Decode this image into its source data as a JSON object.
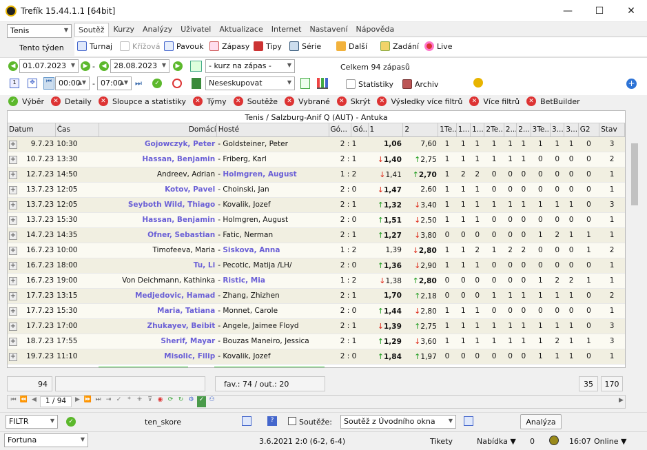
{
  "window": {
    "title": "Trefík 15.44.1.1 [64bit]",
    "minimize": "—",
    "maximize": "☐",
    "close": "✕"
  },
  "sport_select": "Tenis",
  "period_label": "Tento týden",
  "tabs": [
    "Soutěž",
    "Kurzy",
    "Analýzy",
    "Uživatel",
    "Aktualizace",
    "Internet",
    "Nastavení",
    "Nápověda"
  ],
  "toolbar": [
    "Turnaj",
    "Křížová",
    "Pavouk",
    "Zápasy",
    "Tipy",
    "Série",
    "Další",
    "Zadání",
    "Live"
  ],
  "filters": {
    "date_from": "01.07.2023",
    "date_sep": "-",
    "date_to": "28.08.2023",
    "odds_select": "- kurz na zápas -",
    "total_label": "Celkem 94 zápasů",
    "time_from": "00:00",
    "time_sep": "-",
    "time_to": "07:00",
    "group_select": "Neseskupovat",
    "stats_label": "Statistiky",
    "archive_label": "Archiv"
  },
  "filter_tabs": [
    "Výběr",
    "Detaily",
    "Sloupce a statistiky",
    "Týmy",
    "Soutěže",
    "Vybrané",
    "Skrýt",
    "Výsledky více filtrů",
    "Více filtrů",
    "BetBuilder"
  ],
  "grid": {
    "title": "Tenis / Salzburg-Anif Q (AUT)  - Antuka",
    "columns": [
      "Datum",
      "Čas",
      "Domácí",
      "Hosté",
      "Gó...",
      "Gó...",
      "1",
      "2",
      "1Te...",
      "1...",
      "1...",
      "2Te...",
      "2...",
      "2...",
      "3Te...",
      "3...",
      "3...",
      "G2",
      "Stav"
    ],
    "rows": [
      {
        "date": "9.7.23",
        "time": "10:30",
        "home": "Gojowczyk, Peter",
        "away": "Goldsteiner, Peter",
        "score": "2 : 1",
        "o1": "1,06",
        "o1a": "",
        "o2": "7,60",
        "o2a": "",
        "fav": "home",
        "s": [
          "1",
          "1",
          "1",
          "1",
          "1",
          "1",
          "1",
          "1",
          "1",
          "0",
          "3"
        ]
      },
      {
        "date": "10.7.23",
        "time": "13:30",
        "home": "Hassan, Benjamin",
        "away": "Friberg, Karl",
        "score": "2 : 1",
        "o1": "1,40",
        "o1a": "dn",
        "o2": "2,75",
        "o2a": "up",
        "fav": "home",
        "s": [
          "1",
          "1",
          "1",
          "1",
          "1",
          "1",
          "0",
          "0",
          "0",
          "0",
          "2"
        ]
      },
      {
        "date": "12.7.23",
        "time": "14:50",
        "home": "Andreev, Adrian",
        "away": "Holmgren, August",
        "score": "1 : 2",
        "o1": "1,41",
        "o1a": "dn",
        "o2": "2,70",
        "o2a": "up",
        "fav": "away",
        "s": [
          "1",
          "2",
          "2",
          "0",
          "0",
          "0",
          "0",
          "0",
          "0",
          "0",
          "1"
        ]
      },
      {
        "date": "13.7.23",
        "time": "12:05",
        "home": "Kotov, Pavel",
        "away": "Choinski, Jan",
        "score": "2 : 0",
        "o1": "1,47",
        "o1a": "dn",
        "o2": "2,60",
        "o2a": "",
        "fav": "home",
        "s": [
          "1",
          "1",
          "1",
          "0",
          "0",
          "0",
          "0",
          "0",
          "0",
          "0",
          "1"
        ]
      },
      {
        "date": "13.7.23",
        "time": "12:05",
        "home": "Seyboth Wild, Thiago",
        "away": "Kovalik, Jozef",
        "score": "2 : 1",
        "o1": "1,32",
        "o1a": "up",
        "o2": "3,40",
        "o2a": "dn",
        "fav": "home",
        "s": [
          "1",
          "1",
          "1",
          "1",
          "1",
          "1",
          "1",
          "1",
          "1",
          "0",
          "3"
        ]
      },
      {
        "date": "13.7.23",
        "time": "15:30",
        "home": "Hassan, Benjamin",
        "away": "Holmgren, August",
        "score": "2 : 0",
        "o1": "1,51",
        "o1a": "up",
        "o2": "2,50",
        "o2a": "dn",
        "fav": "home",
        "s": [
          "1",
          "1",
          "1",
          "0",
          "0",
          "0",
          "0",
          "0",
          "0",
          "0",
          "1"
        ]
      },
      {
        "date": "14.7.23",
        "time": "14:35",
        "home": "Ofner, Sebastian",
        "away": "Fatic, Nerman",
        "score": "2 : 1",
        "o1": "1,27",
        "o1a": "up",
        "o2": "3,80",
        "o2a": "dn",
        "fav": "home",
        "s": [
          "0",
          "0",
          "0",
          "0",
          "0",
          "0",
          "1",
          "2",
          "1",
          "1",
          "1"
        ]
      },
      {
        "date": "16.7.23",
        "time": "10:00",
        "home": "Timofeeva, Maria",
        "away": "Siskova, Anna",
        "score": "1 : 2",
        "o1": "1,39",
        "o1a": "",
        "o2": "2,80",
        "o2a": "dn",
        "fav": "away",
        "s": [
          "1",
          "1",
          "2",
          "1",
          "2",
          "2",
          "0",
          "0",
          "0",
          "1",
          "2"
        ]
      },
      {
        "date": "16.7.23",
        "time": "18:00",
        "home": "Tu, Li",
        "away": "Pecotic, Matija /LH/",
        "score": "2 : 0",
        "o1": "1,36",
        "o1a": "up",
        "o2": "2,90",
        "o2a": "dn",
        "fav": "home",
        "s": [
          "1",
          "1",
          "1",
          "0",
          "0",
          "0",
          "0",
          "0",
          "0",
          "0",
          "1"
        ]
      },
      {
        "date": "16.7.23",
        "time": "19:00",
        "home": "Von Deichmann, Kathinka",
        "away": "Ristic, Mia",
        "score": "1 : 2",
        "o1": "1,38",
        "o1a": "dn",
        "o2": "2,80",
        "o2a": "up",
        "fav": "away",
        "s": [
          "0",
          "0",
          "0",
          "0",
          "0",
          "0",
          "1",
          "2",
          "2",
          "1",
          "1"
        ]
      },
      {
        "date": "17.7.23",
        "time": "13:15",
        "home": "Medjedovic, Hamad",
        "away": "Zhang, Zhizhen",
        "score": "2 : 1",
        "o1": "1,70",
        "o1a": "",
        "o2": "2,18",
        "o2a": "up",
        "fav": "home",
        "s": [
          "0",
          "0",
          "0",
          "1",
          "1",
          "1",
          "1",
          "1",
          "1",
          "0",
          "2"
        ]
      },
      {
        "date": "17.7.23",
        "time": "15:30",
        "home": "Maria, Tatiana",
        "away": "Monnet, Carole",
        "score": "2 : 0",
        "o1": "1,44",
        "o1a": "up",
        "o2": "2,80",
        "o2a": "dn",
        "fav": "home",
        "s": [
          "1",
          "1",
          "1",
          "0",
          "0",
          "0",
          "0",
          "0",
          "0",
          "0",
          "1"
        ]
      },
      {
        "date": "17.7.23",
        "time": "17:00",
        "home": "Zhukayev, Beibit",
        "away": "Angele, Jaimee Floyd",
        "score": "2 : 1",
        "o1": "1,39",
        "o1a": "dn",
        "o2": "2,75",
        "o2a": "up",
        "fav": "home",
        "s": [
          "1",
          "1",
          "1",
          "1",
          "1",
          "1",
          "1",
          "1",
          "1",
          "0",
          "3"
        ]
      },
      {
        "date": "18.7.23",
        "time": "17:55",
        "home": "Sherif, Mayar",
        "away": "Bouzas Maneiro, Jessica",
        "score": "2 : 1",
        "o1": "1,29",
        "o1a": "up",
        "o2": "3,60",
        "o2a": "dn",
        "fav": "home",
        "s": [
          "1",
          "1",
          "1",
          "1",
          "1",
          "1",
          "1",
          "2",
          "1",
          "1",
          "3"
        ]
      },
      {
        "date": "19.7.23",
        "time": "11:10",
        "home": "Misolic, Filip",
        "away": "Kovalik, Jozef",
        "score": "2 : 0",
        "o1": "1,84",
        "o1a": "up",
        "o2": "1,97",
        "o2a": "up",
        "fav": "home",
        "s": [
          "0",
          "0",
          "0",
          "0",
          "0",
          "0",
          "1",
          "1",
          "1",
          "0",
          "1"
        ]
      }
    ]
  },
  "summary": {
    "count": "94",
    "fav": "fav.: 74 / out.: 20",
    "c1": "35",
    "c2": "170"
  },
  "nav": {
    "page": "1 / 94"
  },
  "bottom": {
    "filter_select": "FILTR",
    "profile": "ten_skore",
    "checkbox_label": "Soutěže:",
    "comp_select": "Soutěž z Úvodního okna",
    "analysis_button": "Analýza"
  },
  "status": {
    "bookmaker": "Fortuna",
    "last_match": "3.6.2021 2:0 (6-2, 6-4)",
    "tickets": "Tikety",
    "offer": "Nabídka ▼",
    "zero": "0",
    "clock": "16:07",
    "online": "Online ▼"
  }
}
